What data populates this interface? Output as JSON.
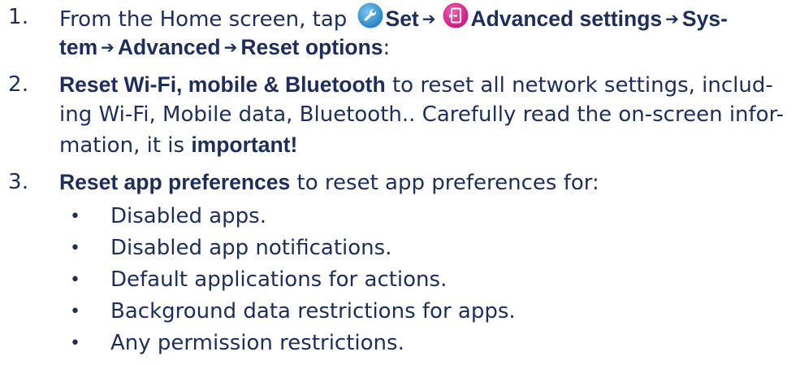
{
  "steps": [
    {
      "number": "1.",
      "line1": {
        "prefix": "From the Home screen, tap ",
        "set_label": "Set",
        "arrow1": "➔",
        "advanced_settings_label": "Advanced settings",
        "arrow2": "➔",
        "sys_label": "Sys-"
      },
      "line2": {
        "tem_label": "tem",
        "arrow3": "➔",
        "advanced_label": "Advanced",
        "arrow4": "➔",
        "reset_options_label": "Reset options",
        "suffix": ":"
      },
      "icons": {
        "settings_icon": "wrench-icon",
        "advanced_icon": "advanced-settings-icon",
        "settings_icon_color": "#2a8fd0",
        "advanced_icon_color": "#d4258a"
      }
    },
    {
      "number": "2.",
      "bold": "Reset Wi-Fi, mobile & Bluetooth",
      "line1_rest": " to reset all network settings, includ-",
      "line2": "ing Wi-Fi, Mobile data, Bluetooth.. Carefully read the on-screen infor-",
      "line3_prefix": "mation, it is ",
      "line3_bold": "important!"
    },
    {
      "number": "3.",
      "bold": "Reset app preferences",
      "rest": " to reset app preferences for:",
      "bullets": [
        "Disabled apps.",
        "Disabled app notifications.",
        "Default applications for actions.",
        "Background data restrictions for apps.",
        "Any permission restrictions."
      ],
      "bullet_glyph": "•"
    }
  ],
  "colors": {
    "text": "#1f2d5a",
    "background": "#ffffff"
  }
}
